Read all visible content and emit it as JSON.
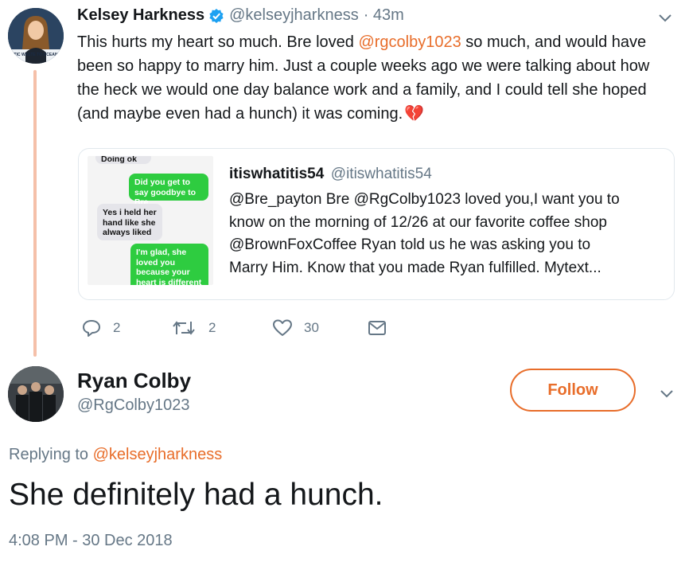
{
  "tweet": {
    "author_name": "Kelsey Harkness",
    "author_handle": "@kelseyjharkness",
    "time": "· 43m",
    "avatar_text": "STIC WASTE TO OCEANS",
    "text_line1_pre": "This hurts my heart so much. Bre loved ",
    "mention": "@rgcolby1023",
    "text_line1_post": " so much, and would have",
    "text_line2": "been so happy to marry him. Just a couple weeks ago we were talking about how",
    "text_line3": "the heck we would one day balance work and a family, and I could tell she hoped",
    "text_line4": "(and maybe even had a hunch) it was coming.",
    "emoji": "💔"
  },
  "quoted": {
    "name": "itiswhatitis54",
    "handle": "@itiswhatitis54",
    "line1": "@Bre_payton Bre @RgColby1023 loved you,I want you to",
    "line2": "know on the morning of 12/26 at our favorite coffee shop",
    "line3": "@BrownFoxCoffee Ryan told us he was asking you to",
    "line4": "Marry Him. Know that you made Ryan fulfilled. Mytext...",
    "image_chat": {
      "top_cut": "Doing ok",
      "b1": "Did you get to say goodbye to Bre",
      "b2": "Yes i held her hand like she always liked",
      "b3": "I'm glad, she loved you because your heart is different"
    }
  },
  "actions": {
    "reply_count": "2",
    "retweet_count": "2",
    "like_count": "30"
  },
  "reply": {
    "author_name": "Ryan Colby",
    "author_handle": "@RgColby1023",
    "follow_label": "Follow",
    "replying_to_label": "Replying to ",
    "replying_to_handle": "@kelseyjharkness",
    "text": "She definitely had a hunch.",
    "timestamp": "4:08 PM - 30 Dec 2018"
  },
  "colors": {
    "accent": "#e86d2a",
    "thread_line": "#f5c0a9",
    "verified": "#1da1f2",
    "muted": "#657786"
  }
}
